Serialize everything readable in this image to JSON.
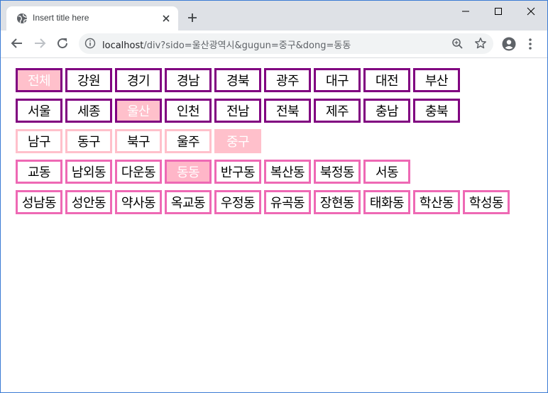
{
  "browser": {
    "tab_title": "Insert title here",
    "url_host": "localhost",
    "url_path": "/div?sido=울산광역시&gugun=중구&dong=동동"
  },
  "colors": {
    "sido_border": "#800080",
    "gugun_border": "#ffc0cb",
    "dong_border": "#ee69b4",
    "selected_fill": "#ffc0cb"
  },
  "sido": {
    "selected": "울산",
    "items": [
      "전체",
      "강원",
      "경기",
      "경남",
      "경북",
      "광주",
      "대구",
      "대전",
      "부산",
      "서울",
      "세종",
      "울산",
      "인천",
      "전남",
      "전북",
      "제주",
      "충남",
      "충북"
    ],
    "selected_flags": [
      true,
      false,
      false,
      false,
      false,
      false,
      false,
      false,
      false,
      false,
      false,
      true,
      false,
      false,
      false,
      false,
      false,
      false
    ]
  },
  "gugun": {
    "selected": "중구",
    "items": [
      "남구",
      "동구",
      "북구",
      "울주",
      "중구"
    ],
    "selected_flags": [
      false,
      false,
      false,
      false,
      true
    ]
  },
  "dong": {
    "selected": "동동",
    "items": [
      "교동",
      "남외동",
      "다운동",
      "동동",
      "반구동",
      "복산동",
      "북정동",
      "서동",
      "성남동",
      "성안동",
      "약사동",
      "옥교동",
      "우정동",
      "유곡동",
      "장현동",
      "태화동",
      "학산동",
      "학성동"
    ],
    "selected_flags": [
      false,
      false,
      false,
      true,
      false,
      false,
      false,
      false,
      false,
      false,
      false,
      false,
      false,
      false,
      false,
      false,
      false,
      false
    ]
  }
}
